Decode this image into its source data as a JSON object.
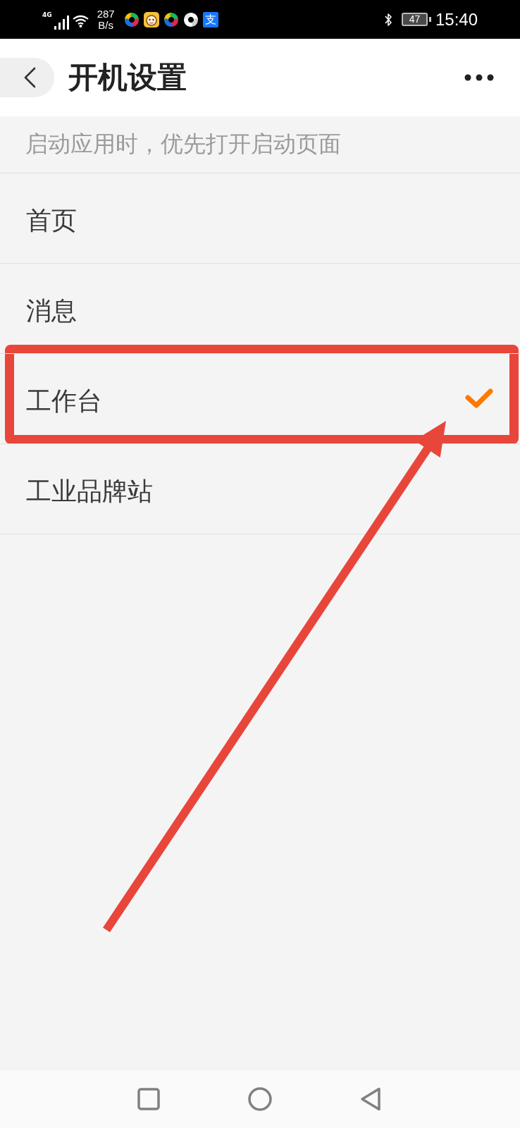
{
  "status_bar": {
    "network_type": "4G",
    "speed": "287",
    "speed_unit": "B/s",
    "app_icons": [
      {
        "kind": "swirl"
      },
      {
        "kind": "mascot"
      },
      {
        "kind": "swirl"
      },
      {
        "kind": "swirl_mono"
      },
      {
        "kind": "glyph_tile",
        "glyph": "支"
      }
    ],
    "battery": "47",
    "time": "15:40"
  },
  "header": {
    "title": "开机设置"
  },
  "hint": "启动应用时，优先打开启动页面",
  "options": [
    {
      "label": "首页",
      "selected": false
    },
    {
      "label": "消息",
      "selected": false
    },
    {
      "label": "工作台",
      "selected": true
    },
    {
      "label": "工业品牌站",
      "selected": false
    }
  ],
  "nav_bar": {
    "buttons": [
      {
        "kind": "recents"
      },
      {
        "kind": "home"
      },
      {
        "kind": "back"
      }
    ]
  }
}
